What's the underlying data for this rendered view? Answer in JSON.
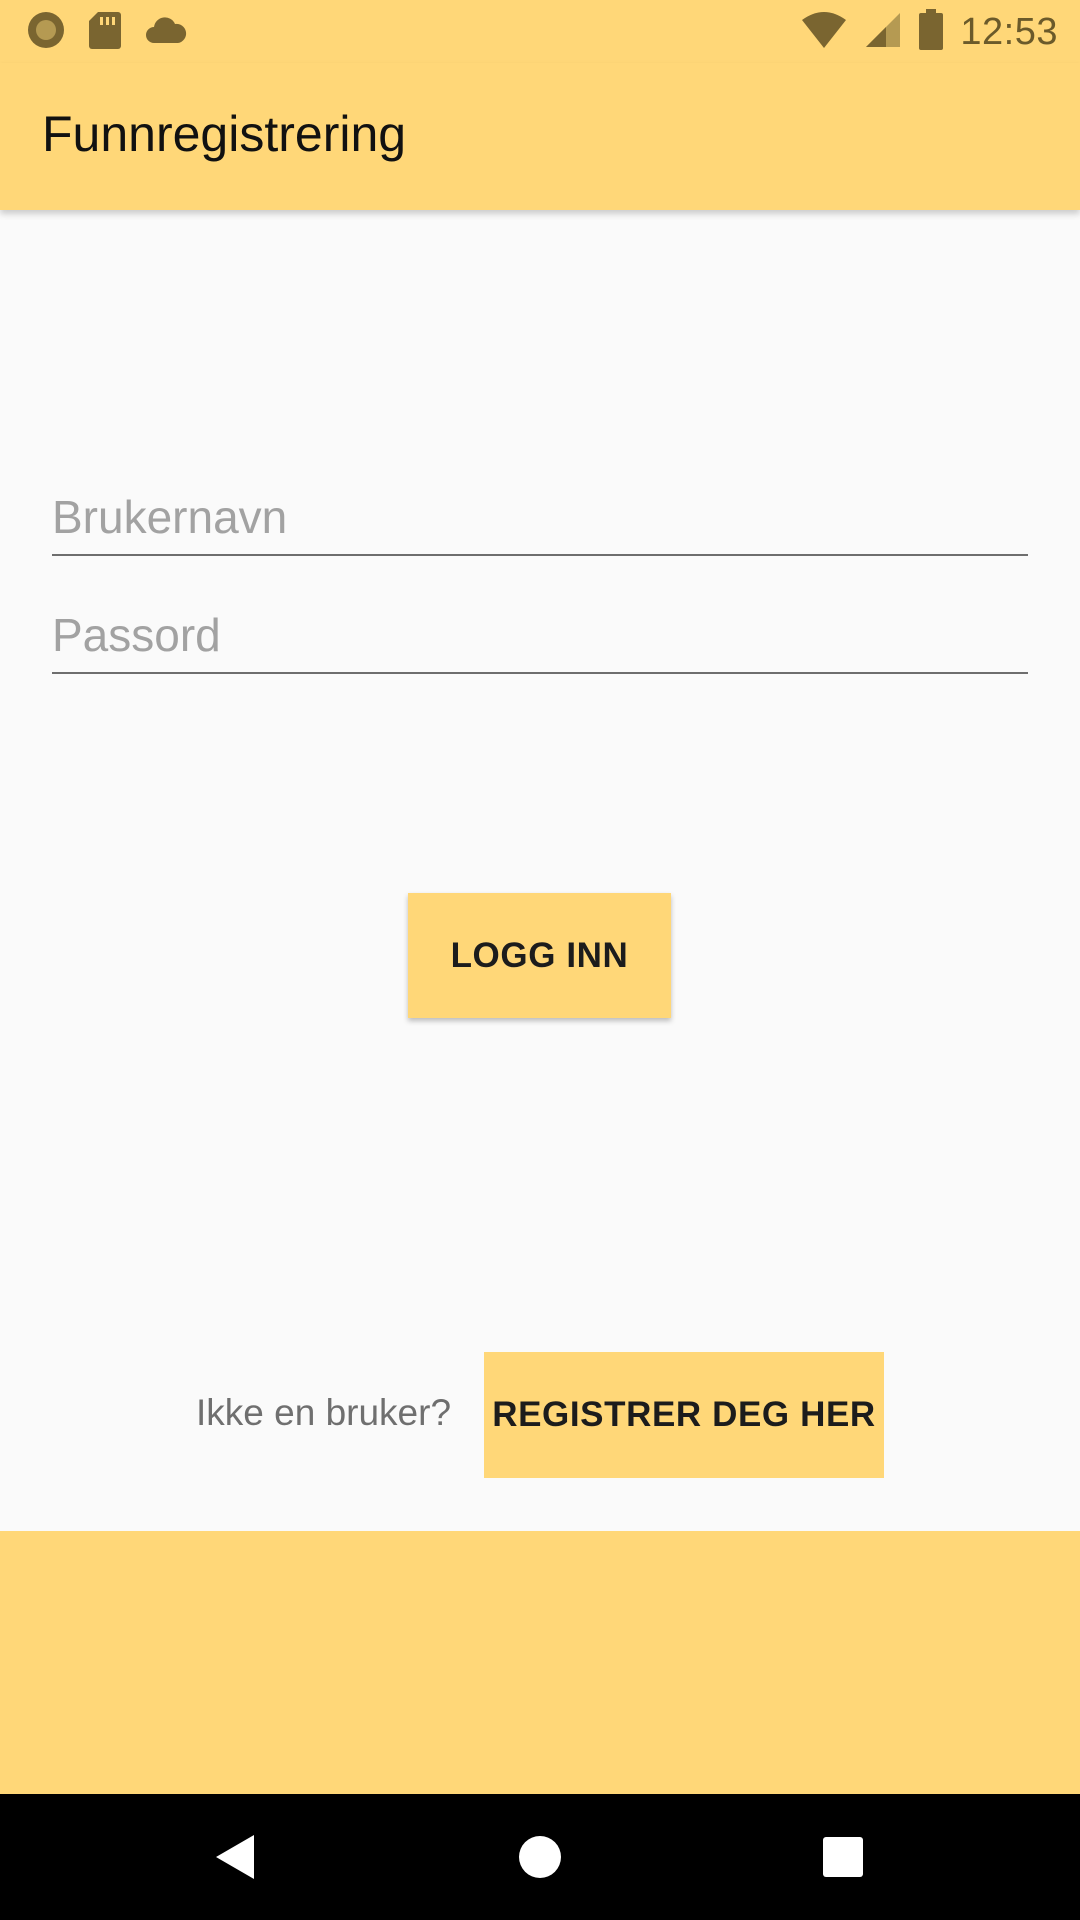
{
  "status_bar": {
    "time": "12:53",
    "left_icons": [
      "record-icon",
      "sd-card-icon",
      "cloud-icon"
    ],
    "right_icons": [
      "wifi-icon",
      "signal-icon",
      "battery-icon"
    ]
  },
  "app_bar": {
    "title": "Funnregistrering"
  },
  "form": {
    "username_placeholder": "Brukernavn",
    "username_value": "",
    "password_placeholder": "Passord",
    "password_value": "",
    "login_label": "LOGG INN"
  },
  "register": {
    "prompt": "Ikke en bruker?",
    "button_label": "REGISTRER DEG HER"
  },
  "colors": {
    "accent": "#ffd778",
    "background": "#fafafa",
    "nav_bar": "#000000"
  },
  "nav_bar": {
    "buttons": [
      "back-icon",
      "home-icon",
      "recents-icon"
    ]
  }
}
